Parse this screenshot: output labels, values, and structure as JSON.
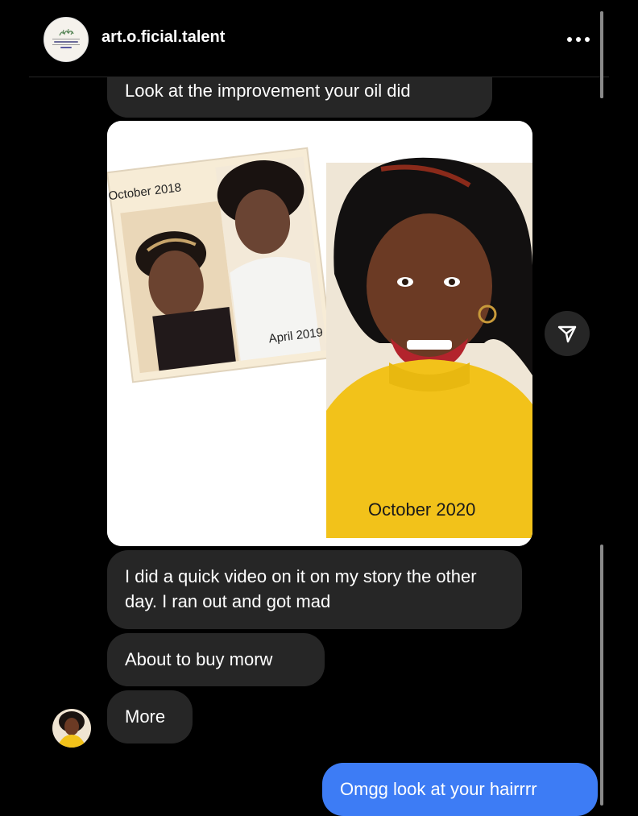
{
  "header": {
    "username": "art.o.ficial.talent",
    "more_icon": "more-horizontal-icon",
    "avatar_logo_text": "A.R.T.O.Ficial Growth Oil"
  },
  "messages": [
    {
      "sender": "them",
      "text": "Look at the improvement your oil did"
    },
    {
      "sender": "them",
      "type": "image",
      "photo_labels": {
        "first": "October 2018",
        "second": "April 2019",
        "third": "October 2020"
      }
    },
    {
      "sender": "them",
      "text": "I did a quick video on it on my story the other day. I ran out and got mad"
    },
    {
      "sender": "them",
      "text": "About to buy morw"
    },
    {
      "sender": "them",
      "text": "More"
    },
    {
      "sender": "me",
      "text": "Omgg look at your hairrrr"
    }
  ],
  "actions": {
    "share_icon": "paper-plane-icon"
  },
  "colors": {
    "background": "#000000",
    "their_bubble": "#262626",
    "my_bubble": "#3d7cf5",
    "text": "#ffffff"
  }
}
